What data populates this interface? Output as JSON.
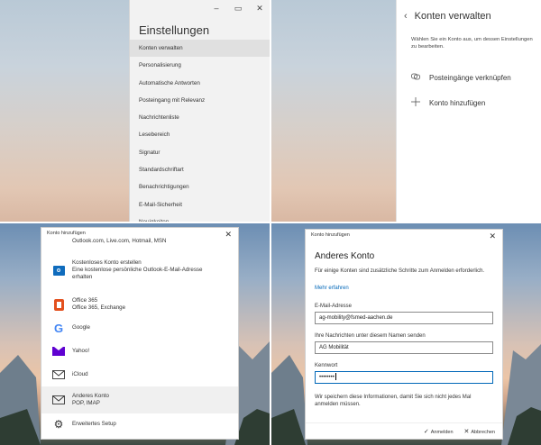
{
  "settings": {
    "title": "Einstellungen",
    "window_controls": [
      "–",
      "▭",
      "✕"
    ],
    "items": [
      "Konten verwalten",
      "Personalisierung",
      "Automatische Antworten",
      "Posteingang mit Relevanz",
      "Nachrichtenliste",
      "Lesebereich",
      "Signatur",
      "Standardschriftart",
      "Benachrichtigungen",
      "E-Mail-Sicherheit",
      "Neuigkeiten"
    ]
  },
  "manage_accounts": {
    "back_icon": "‹",
    "title": "Konten verwalten",
    "description": "Wählen Sie ein Konto aus, um dessen Einstellungen zu bearbeiten.",
    "link_inboxes": "Posteingänge verknüpfen",
    "add_account": "Konto hinzufügen"
  },
  "add_account_dialog": {
    "title": "Konto hinzufügen",
    "close": "✕",
    "accounts": [
      {
        "icon": "outlook-icon",
        "lines": [
          "Outlook.com, Live.com, Hotmail, MSN"
        ]
      },
      {
        "icon": "outlook-icon",
        "lines": [
          "Kostenloses Konto erstellen",
          "Eine kostenlose persönliche Outlook-E-Mail-Adresse",
          "erhalten"
        ]
      },
      {
        "icon": "office-icon",
        "lines": [
          "Office 365",
          "Office 365, Exchange"
        ]
      },
      {
        "icon": "google-icon",
        "lines": [
          "Google"
        ]
      },
      {
        "icon": "yahoo-icon",
        "lines": [
          "Yahoo!"
        ]
      },
      {
        "icon": "mail-icon",
        "lines": [
          "iCloud"
        ]
      },
      {
        "icon": "mail-icon",
        "lines": [
          "Anderes Konto",
          "POP, IMAP"
        ]
      },
      {
        "icon": "gear-icon",
        "lines": [
          "Erweitertes Setup"
        ]
      }
    ]
  },
  "other_account_dialog": {
    "header": "Konto hinzufügen",
    "close": "✕",
    "title": "Anderes Konto",
    "intro": "Für einige Konten sind zusätzliche Schritte zum Anmelden erforderlich.",
    "learn_more": "Mehr erfahren",
    "email_label": "E-Mail-Adresse",
    "email_value": "ag-mobility@fsmed-aachen.de",
    "name_label": "Ihre Nachrichten unter diesem Namen senden",
    "name_value": "AG Mobilität",
    "password_label": "Kennwort",
    "password_value": "••••••••",
    "note": "Wir speichern diese Informationen, damit Sie sich nicht jedes Mal anmelden müssen.",
    "signin": "Anmelden",
    "cancel": "Abbrechen"
  }
}
